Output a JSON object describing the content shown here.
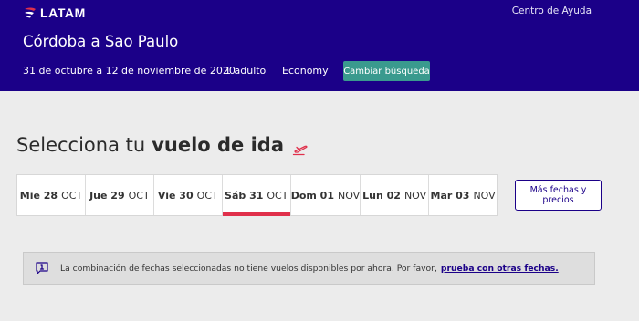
{
  "header": {
    "brand": "LATAM",
    "help_link": "Centro de Ayuda"
  },
  "search_summary": {
    "route": "Córdoba a Sao Paulo",
    "dates": "31 de octubre a 12 de noviembre de 2020",
    "passengers": "1 adulto",
    "cabin": "Economy",
    "change_button": "Cambiar búsqueda"
  },
  "selection": {
    "title_prefix": "Selecciona tu",
    "title_bold": "vuelo de ida"
  },
  "date_options": [
    {
      "day": "Mie 28",
      "month": "OCT",
      "selected": false
    },
    {
      "day": "Jue 29",
      "month": "OCT",
      "selected": false
    },
    {
      "day": "Vie 30",
      "month": "OCT",
      "selected": false
    },
    {
      "day": "Sáb 31",
      "month": "OCT",
      "selected": true
    },
    {
      "day": "Dom 01",
      "month": "NOV",
      "selected": false
    },
    {
      "day": "Lun 02",
      "month": "NOV",
      "selected": false
    },
    {
      "day": "Mar 03",
      "month": "NOV",
      "selected": false
    }
  ],
  "more_dates_button": "Más fechas y precios",
  "alert": {
    "message": "La combinación de fechas seleccionadas no tiene vuelos disponibles por ahora. Por favor,",
    "link": "prueba con otras fechas."
  },
  "colors": {
    "brand": "#1b0088",
    "accent": "#e0304b",
    "button_teal": "#3a9a8e"
  },
  "icons": {
    "logo": "latam-logo-icon",
    "plane": "plane-takeoff-icon",
    "alert": "info-chat-icon"
  }
}
